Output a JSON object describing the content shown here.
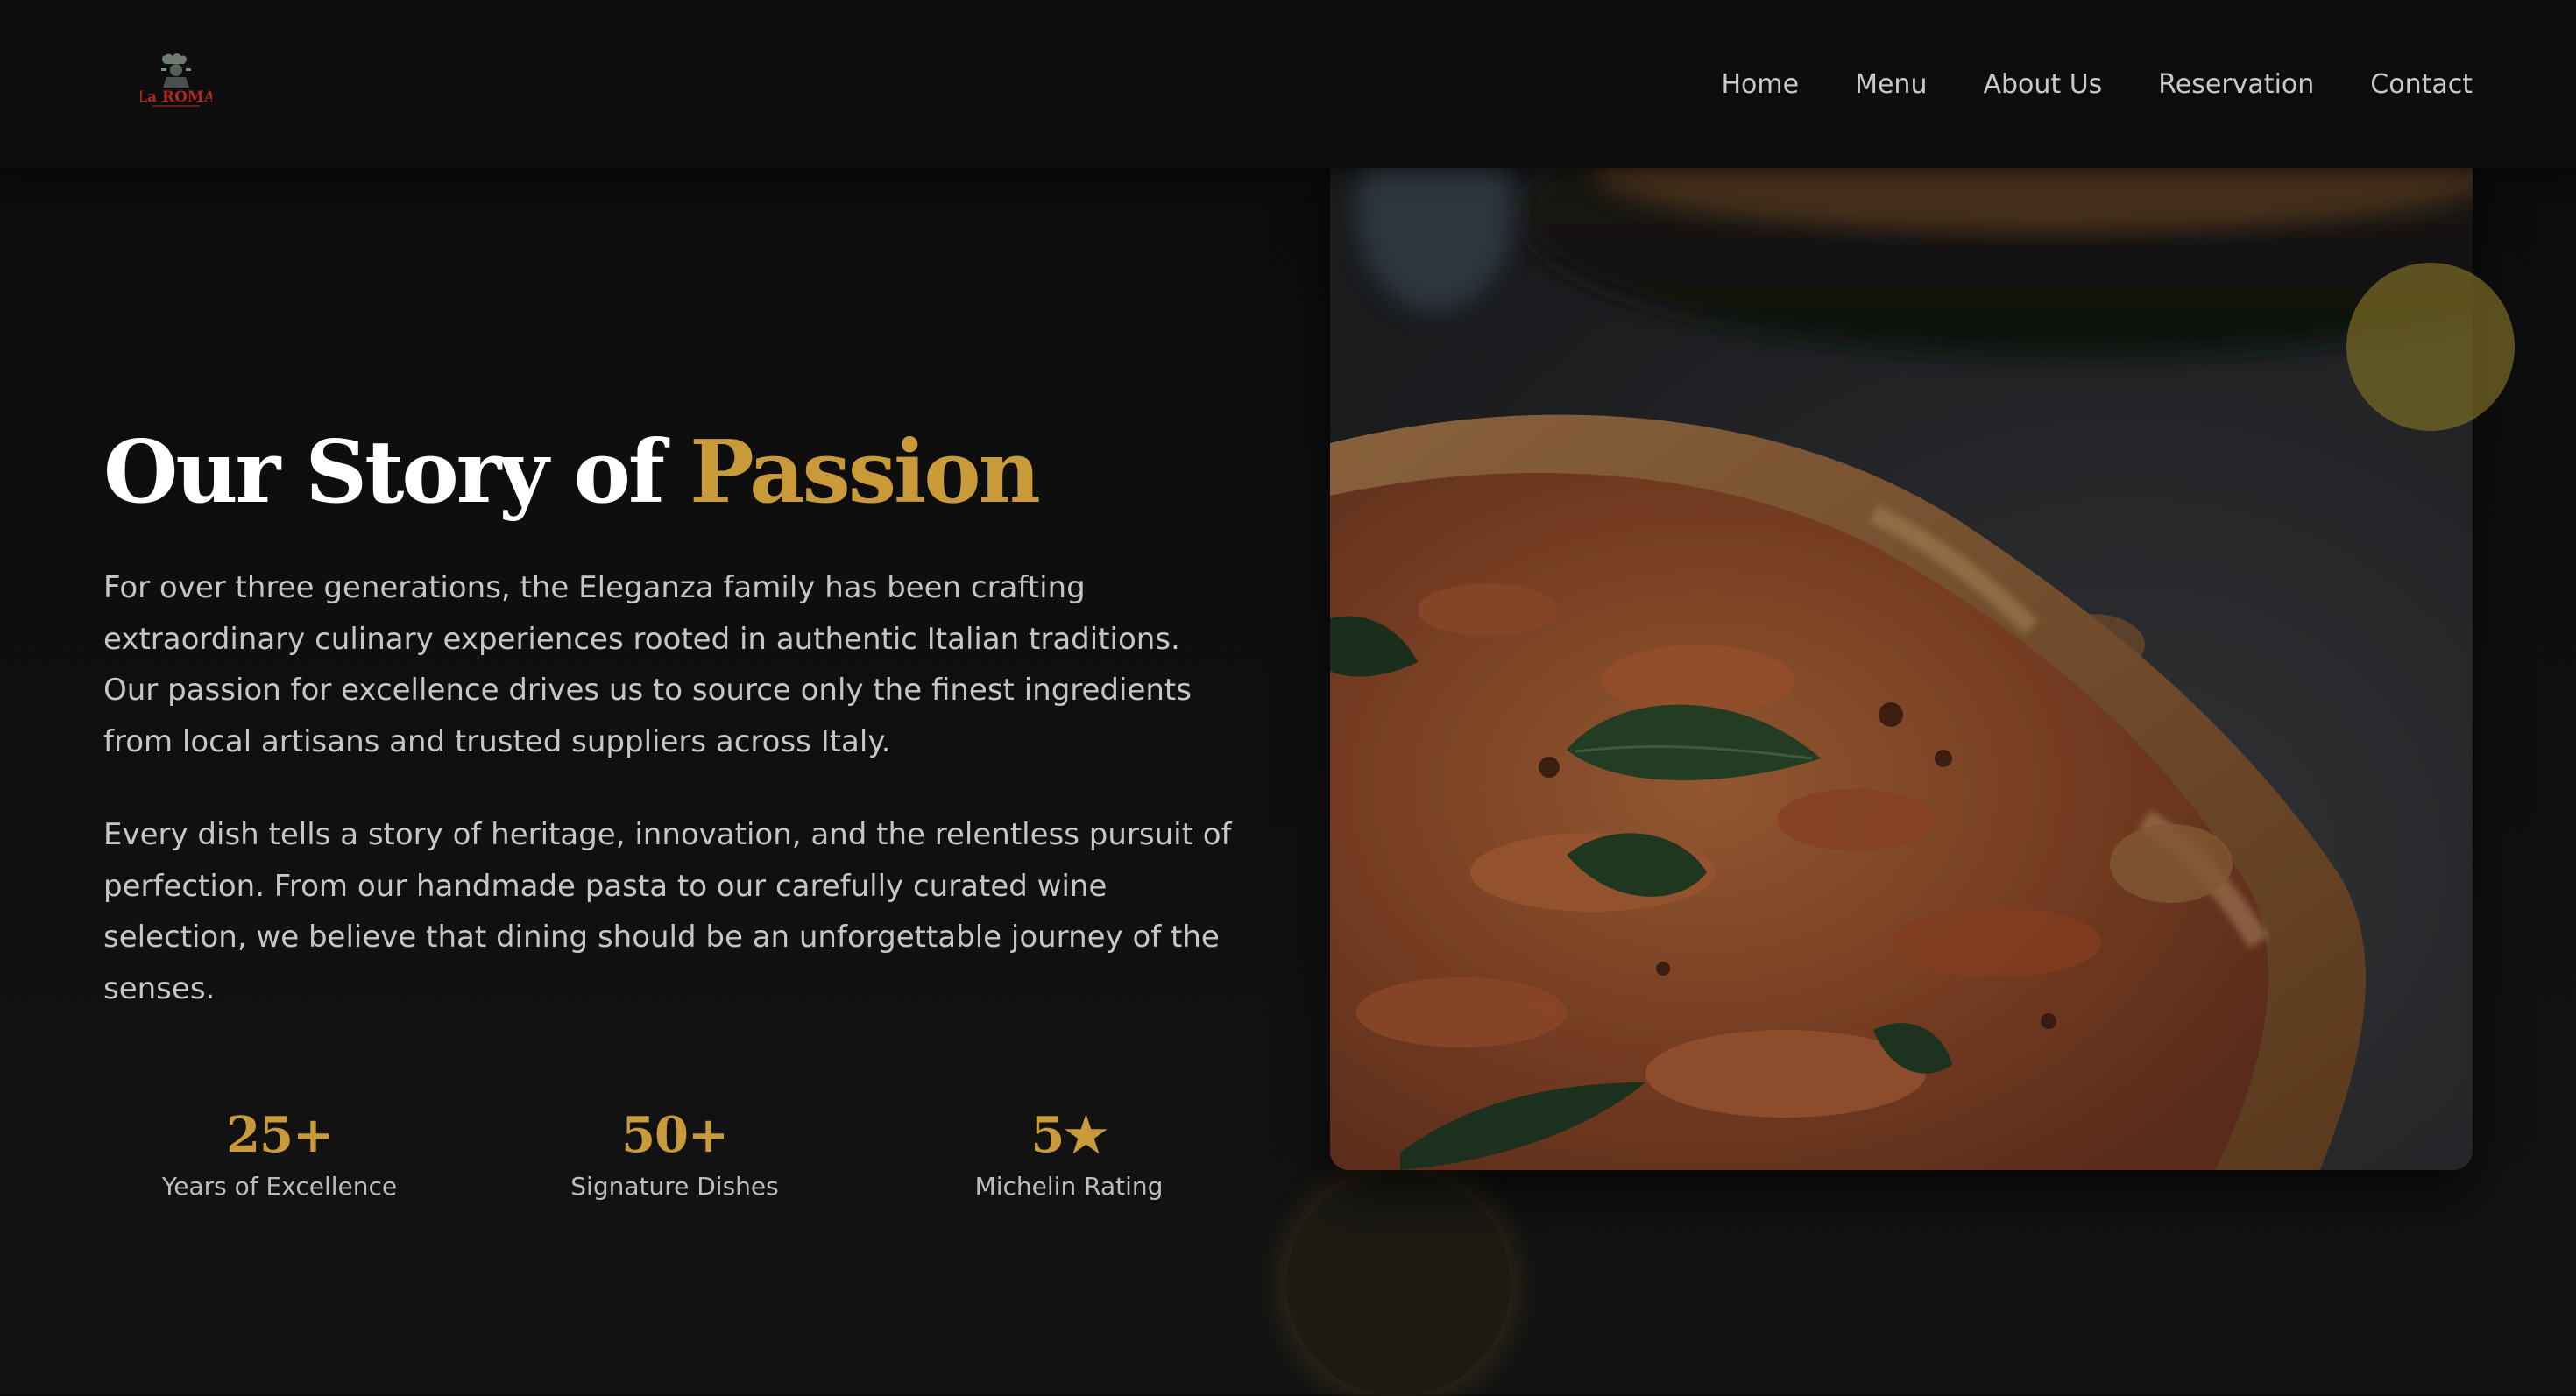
{
  "brand": {
    "logo_text": "La ROMA"
  },
  "nav": {
    "items": [
      {
        "label": "Home"
      },
      {
        "label": "Menu"
      },
      {
        "label": "About Us"
      },
      {
        "label": "Reservation"
      },
      {
        "label": "Contact"
      }
    ]
  },
  "about": {
    "title_main": "Our Story of",
    "title_accent": "Passion",
    "paragraphs": [
      "For over three generations, the Eleganza family has been crafting extraordinary culinary experiences rooted in authentic Italian traditions. Our passion for excellence drives us to source only the finest ingredients from local artisans and trusted suppliers across Italy.",
      "Every dish tells a story of heritage, innovation, and the relentless pursuit of perfection. From our handmade pasta to our carefully curated wine selection, we believe that dining should be an unforgettable journey of the senses."
    ],
    "stats": [
      {
        "value": "25+",
        "label": "Years of Excellence"
      },
      {
        "value": "50+",
        "label": "Signature Dishes"
      },
      {
        "value": "5★",
        "label": "Michelin Rating"
      }
    ]
  },
  "colors": {
    "background": "#0e0e0e",
    "header": "#0d0d0d",
    "accent_gold": "#c99a3a",
    "text_primary": "#ffffff",
    "text_body": "#c6c6c6",
    "logo_red": "#b3261e"
  }
}
